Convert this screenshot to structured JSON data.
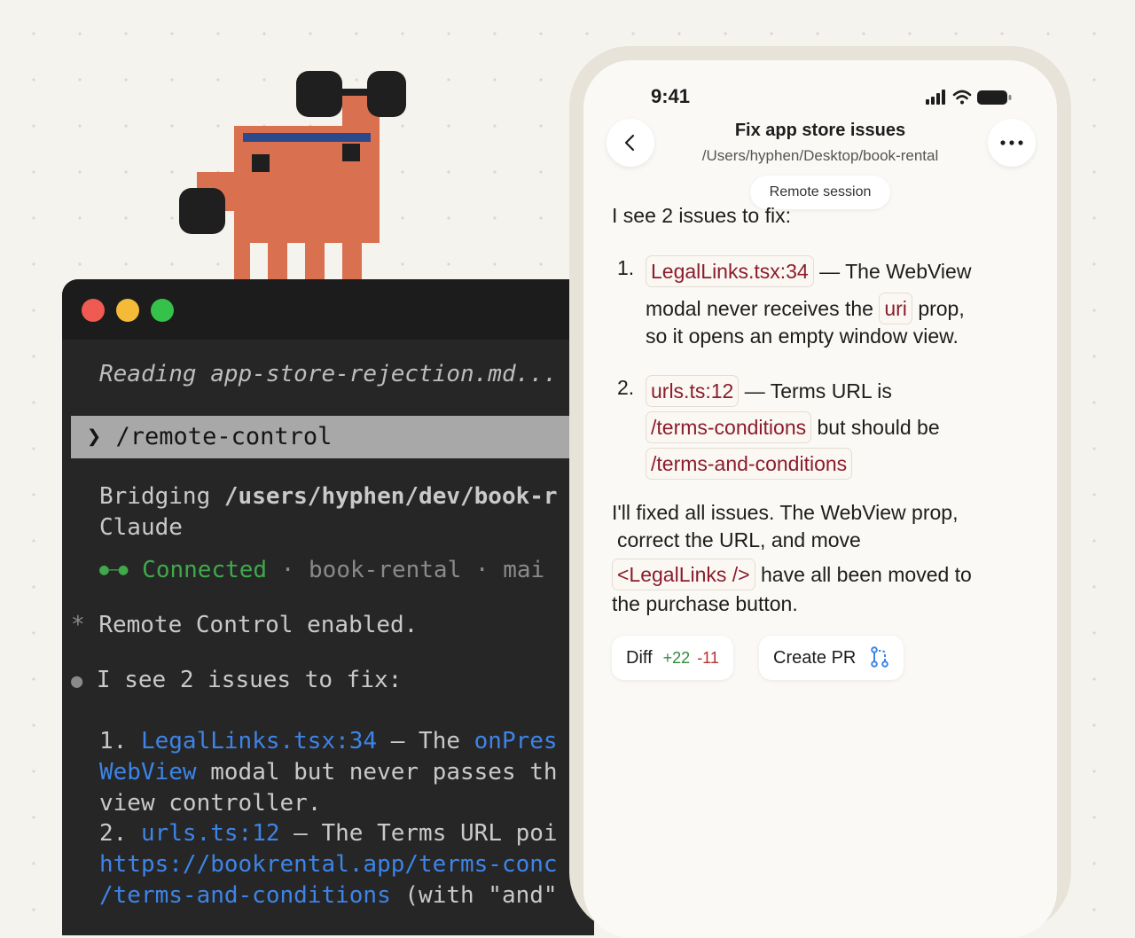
{
  "terminal": {
    "reading": "Reading app-store-rejection.md...",
    "prompt_symbol": "❯",
    "command": "/remote-control",
    "bridging_prefix": "Bridging ",
    "bridging_path": "/users/hyphen/dev/book-r",
    "bridging_end": "Claude",
    "connected_glyph": "●—●",
    "connected": "Connected",
    "sep1": " · ",
    "project": "book-rental",
    "sep2": " · ",
    "branch_partial": "mai",
    "star": "*",
    "remote_enabled": "Remote Control enabled.",
    "bullet": "●",
    "issues_intro": "I see 2 issues to fix:",
    "item1_num": "1.",
    "item1_file": "LegalLinks.tsx:34",
    "item1_dash": " — The ",
    "item1_prop": "onPres",
    "item1_l2_a": "WebView",
    "item1_l2_b": " modal but never passes th",
    "item1_l3": "view controller.",
    "item2_num": "2.",
    "item2_file": "urls.ts:12",
    "item2_rest": " — The Terms URL poi",
    "item2_url": "https://bookrental.app/terms-conc",
    "item2_path": "/terms-and-conditions",
    "item2_tail": " (with \"and\""
  },
  "phone": {
    "time": "9:41",
    "title": "Fix app store issues",
    "subtitle": "/Users/hyphen/Desktop/book-rental",
    "session_pill": "Remote session",
    "intro": "I see 2 issues to fix:",
    "item1": {
      "num": "1.",
      "code": "LegalLinks.tsx:34",
      "text1": "— The WebView",
      "text2": "modal never receives the",
      "code2": "uri",
      "text3": "prop,",
      "text4": "so it opens an empty window view."
    },
    "item2": {
      "num": "2.",
      "code": "urls.ts:12",
      "text1": "— Terms URL is",
      "code2": "/terms-conditions",
      "text2": "but should be",
      "code3": "/terms-and-conditions"
    },
    "summary": {
      "line1": "I'll fixed all issues. The WebView prop,",
      "line2": "correct the URL, and move",
      "code": "<LegalLinks />",
      "line3": "have all been moved to",
      "line4": "the purchase button."
    },
    "actions": {
      "diff_label": "Diff",
      "diff_add": "+22",
      "diff_del": "-11",
      "pr_label": "Create PR"
    }
  },
  "colors": {
    "accent_code": "#8b1c2c",
    "terminal_bg": "#262626",
    "mascot": "#d9704f",
    "link_blue": "#3d84e8",
    "connected_green": "#3fa94c"
  }
}
